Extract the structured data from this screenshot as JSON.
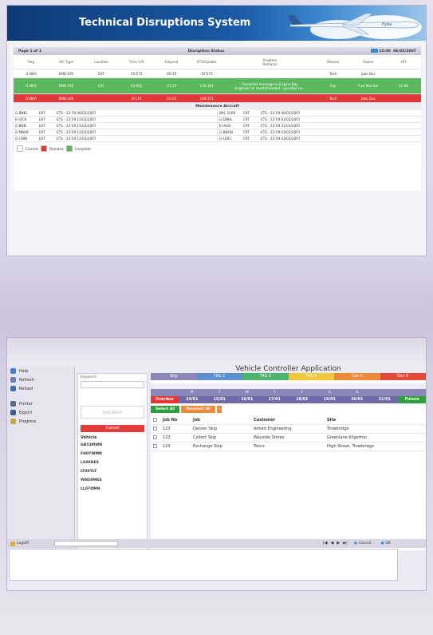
{
  "tds": {
    "title": "Technical Disruptions System",
    "page_label": "Page 1 of 1",
    "status_title": "Disruption Status",
    "time": "15:00",
    "date": "06/02/2007",
    "columns": [
      "Reg",
      "A/C Type",
      "Location",
      "Time U/S",
      "Elapsed",
      "ETS/Update",
      "Problem",
      "Reason",
      "Owner",
      "ATI"
    ],
    "problem_sub": "Remarks",
    "rows": [
      {
        "status": "current",
        "cells": [
          "G-NKA",
          "EMB-195",
          "EXT",
          "10:572",
          "00:35",
          "10:572",
          "",
          "Tech",
          "Jobs Doc",
          ""
        ]
      },
      {
        "status": "complete",
        "cells": [
          "G-NKA",
          "EMB-195",
          "EXT",
          "03:002",
          "01:25",
          "134:361",
          "",
          "Exp",
          "Fuel Monitor",
          "11:04"
        ],
        "problem_lines": [
          "Prompted message in Engine Bay",
          "Engineer on meets/needed - possible cu..."
        ]
      },
      {
        "status": "overdue",
        "cells": [
          "G-NKA",
          "EMB-195",
          "",
          "9:172",
          "01:25",
          "109:371",
          "",
          "Tech",
          "Jobs Doc",
          ""
        ]
      }
    ],
    "maintenance_title": "Maintenance Aircraft",
    "maint_left": [
      [
        "G-BNKL",
        "EXT",
        "ETS - 23:59 06/02/2007"
      ],
      [
        "EI-DCK",
        "EXT",
        "ETS - 23:59 15/02/2007"
      ],
      [
        "G-BNEI",
        "EXT",
        "ETS - 23:59 15/02/2007"
      ],
      [
        "G-NNAB",
        "EXT",
        "ETS - 23:59 12/02/2007"
      ],
      [
        "G-CNNI",
        "EXT",
        "ETS - 23:59 12/02/2007"
      ]
    ],
    "maint_right": [
      [
        "BRL 100R",
        "CRT",
        "ETS - 23:59 06/02/2007"
      ],
      [
        "G-DNHL",
        "CRT",
        "ETS - 23:59 01/02/2007"
      ],
      [
        "EI-AUD",
        "CRT",
        "ETS - 23:59 31/01/2007"
      ],
      [
        "G-BNGN",
        "CRT",
        "ETS - 23:59 03/02/2007"
      ],
      [
        "G-UDFL",
        "CRT",
        "ETS - 23:59 03/02/2007"
      ]
    ],
    "legend": {
      "current": "Current",
      "overdue": "Overdue",
      "complete": "Complete"
    },
    "colors": {
      "current": "#ffffff",
      "overdue": "#de3a3a",
      "complete": "#5cb85c",
      "banner": "#1a5aa6"
    }
  },
  "vca": {
    "title": "Vehicle Controller Application",
    "nav": [
      {
        "label": "Help",
        "icon": "help-icon",
        "color": "#3f7fd6"
      },
      {
        "label": "Refresh",
        "icon": "refresh-icon",
        "color": "#6a7fb8"
      },
      {
        "label": "Reload",
        "icon": "reload-icon",
        "color": "#3c6fb0"
      },
      {
        "label": "Printer",
        "icon": "printer-icon",
        "color": "#5a6c8a"
      },
      {
        "label": "Export",
        "icon": "export-icon",
        "color": "#3a5a9a"
      },
      {
        "label": "Progress",
        "icon": "progress-icon",
        "color": "#caa83a"
      }
    ],
    "logoff": "LogOff",
    "keyword_label": "Keyword",
    "add_btn": "Add Work",
    "cancel_btn": "Cancel",
    "vehicle_header": "Vehicle",
    "vehicles": [
      "GB53MWN",
      "FH07WMN",
      "LS09DES",
      "LT08YLT",
      "WN58MKS",
      "LL07DMN"
    ],
    "tabs": [
      {
        "label": "Skip",
        "color": "#8b88b9"
      },
      {
        "label": "TAG 2",
        "color": "#5b8fd1"
      },
      {
        "label": "TAG 3",
        "color": "#4bb56d"
      },
      {
        "label": "TAG 4",
        "color": "#f0c63a"
      },
      {
        "label": "Dan 5",
        "color": "#f0883a"
      },
      {
        "label": "Dan 6",
        "color": "#e44a3a"
      }
    ],
    "day_letters": [
      "",
      "M",
      "T",
      "W",
      "T",
      "F",
      "S",
      "S",
      "",
      ""
    ],
    "days": [
      "Overdue",
      "14/01",
      "15/01",
      "16/01",
      "17/01",
      "18/01",
      "19/01",
      "20/01",
      "21/01",
      "Future"
    ],
    "select_all": "Select All",
    "deselect_all": "Deselect All",
    "job_columns": [
      "Job No",
      "Job",
      "Customer",
      "Site"
    ],
    "jobs": [
      {
        "no": "123",
        "job": "Deliver Skip",
        "customer": "Aimed Engineering",
        "site": "Trowbridge"
      },
      {
        "no": "123",
        "job": "Collect Skip",
        "customer": "Wayside Stores",
        "site": "Greenlane Kilgerton"
      },
      {
        "no": "123",
        "job": "Exchange Skip",
        "customer": "Tesco",
        "site": "High Street, Trowbridge"
      }
    ],
    "cancel_label": "Cancel",
    "ok_label": "OK"
  }
}
